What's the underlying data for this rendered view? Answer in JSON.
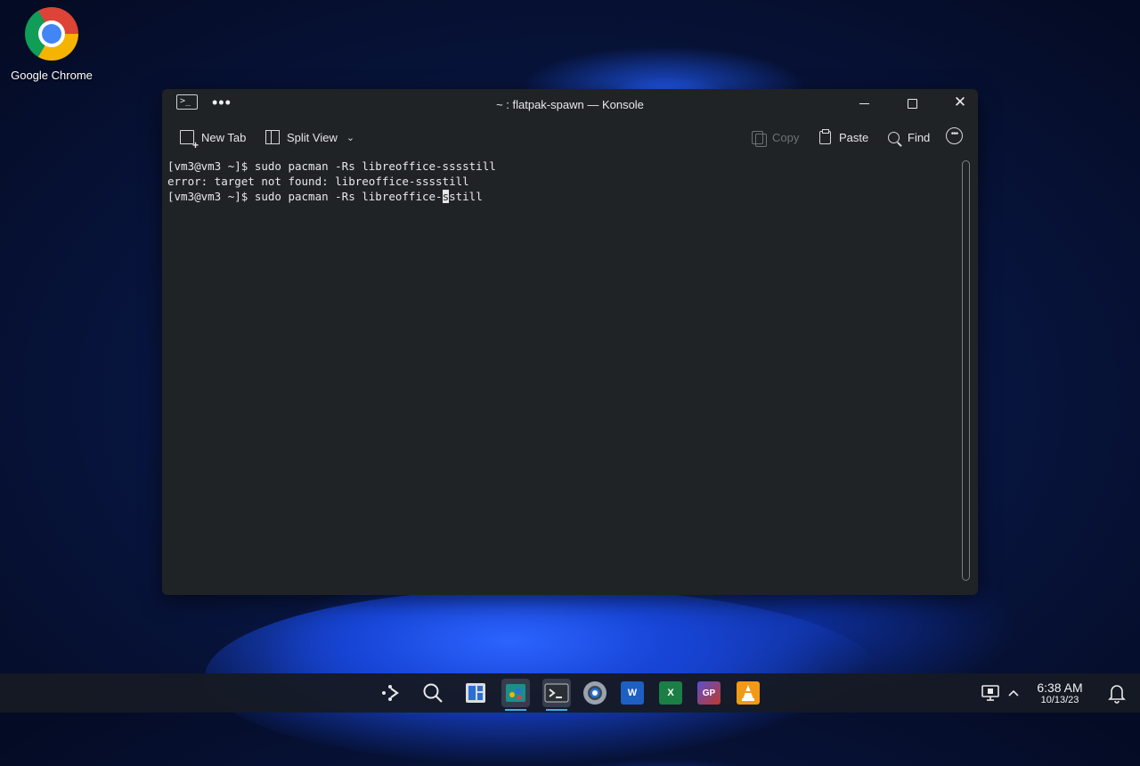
{
  "desktop": {
    "icons": [
      {
        "label": "Google Chrome",
        "icon": "chrome-icon"
      }
    ]
  },
  "window": {
    "title": "~ : flatpak-spawn — Konsole",
    "app_icon": "terminal-icon",
    "controls": {
      "minimize": "minimize-icon",
      "maximize": "maximize-icon",
      "close": "close-icon"
    }
  },
  "toolbar": {
    "new_tab": "New Tab",
    "split_view": "Split View",
    "copy": "Copy",
    "paste": "Paste",
    "find": "Find"
  },
  "terminal": {
    "lines": [
      "[vm3@vm3 ~]$ sudo pacman -Rs libreoffice-sssstill",
      "error: target not found: libreoffice-sssstill"
    ],
    "current_line": {
      "before_cursor": "[vm3@vm3 ~]$ sudo pacman -Rs libreoffice-",
      "cursor_char": "s",
      "after_cursor": "still"
    }
  },
  "taskbar": {
    "apps": [
      "app-launcher-icon",
      "search-icon",
      "task-view-icon",
      "store-icon",
      "konsole-icon",
      "settings-icon",
      "word-icon",
      "excel-icon",
      "powerpoint-icon",
      "vlc-icon"
    ],
    "word_letter": "W",
    "excel_letter": "X",
    "gp_letter": "GP",
    "clock_time": "6:38 AM",
    "clock_date": "10/13/23"
  },
  "colors": {
    "terminal_bg": "#202326",
    "accent": "#3daee9",
    "word": "#1e5fc4",
    "excel": "#1b7f45"
  }
}
